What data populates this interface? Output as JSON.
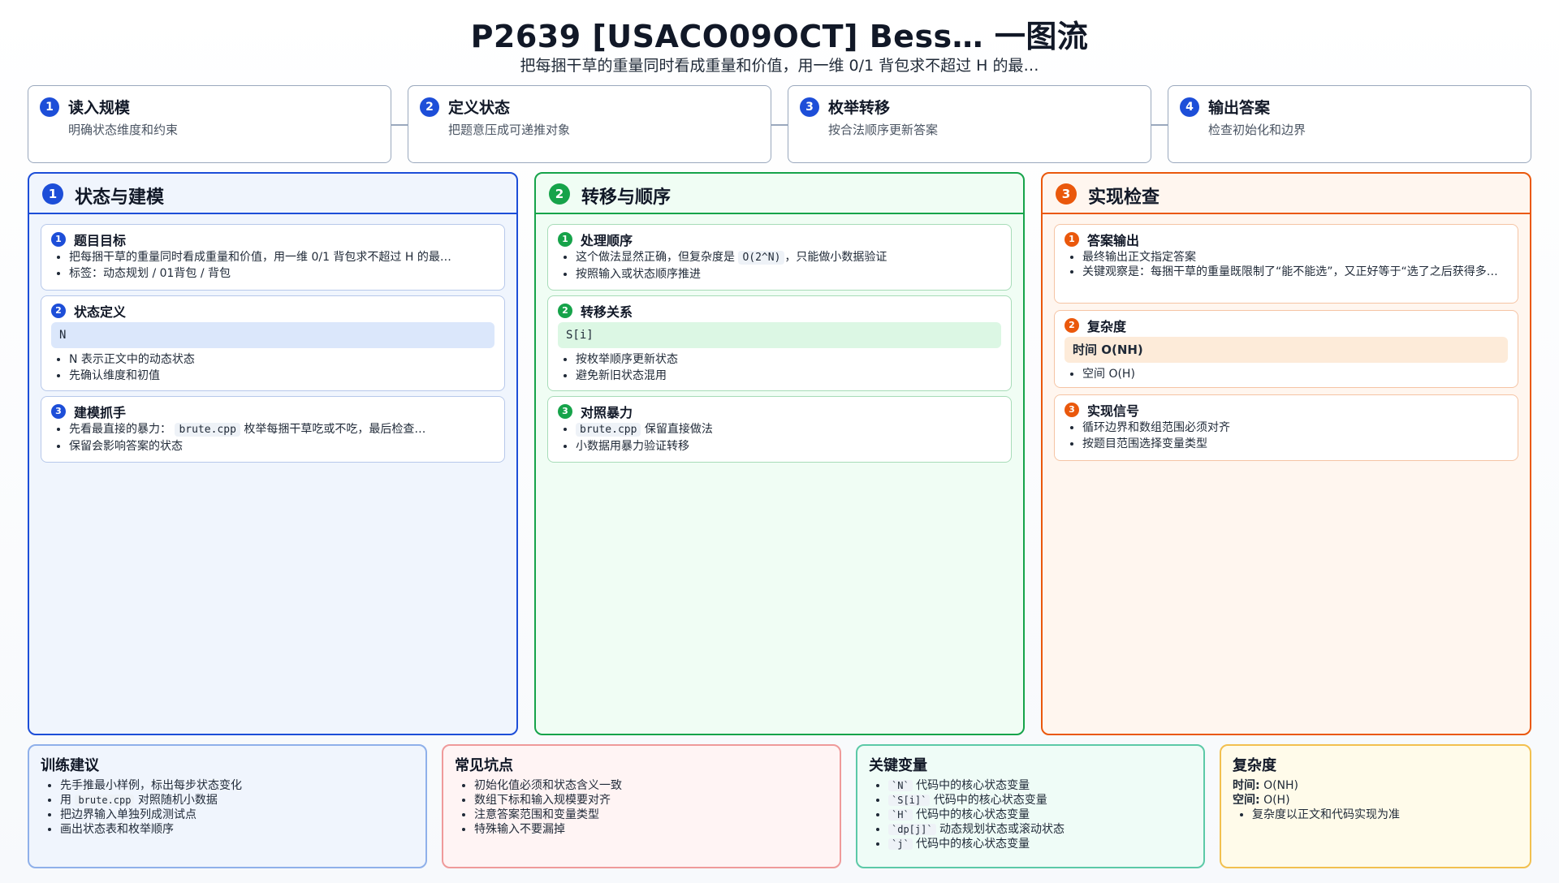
{
  "header": {
    "title": "P2639 [USACO09OCT] Bess… 一图流",
    "subtitle": "把每捆干草的重量同时看成重量和价值，用一维 0/1 背包求不超过 H 的最…"
  },
  "steps": [
    {
      "num": "1",
      "title": "读入规模",
      "desc": "明确状态维度和约束"
    },
    {
      "num": "2",
      "title": "定义状态",
      "desc": "把题意压成可递推对象"
    },
    {
      "num": "3",
      "title": "枚举转移",
      "desc": "按合法顺序更新答案"
    },
    {
      "num": "4",
      "title": "输出答案",
      "desc": "检查初始化和边界"
    }
  ],
  "colors": {
    "blue": "#1d4ed8",
    "green": "#16a34a",
    "orange": "#ea580c",
    "blue_bg": "#f0f5fd",
    "green_bg": "#f0fdf4",
    "orange_bg": "#fff6ef"
  },
  "columns": {
    "c1": {
      "num": "1",
      "title": "状态与建模",
      "cards": {
        "a": {
          "num": "1",
          "title": "题目目标",
          "items": [
            "把每捆干草的重量同时看成重量和价值，用一维 0/1 背包求不超过 H 的最…",
            "标签：动态规划 / 01背包 / 背包"
          ]
        },
        "b": {
          "num": "2",
          "title": "状态定义",
          "code": "N",
          "items": [
            "N 表示正文中的动态状态",
            "先确认维度和初值"
          ]
        },
        "c": {
          "num": "3",
          "title": "建模抓手",
          "item1_pre": "先看最直接的暴力：",
          "item1_code": "brute.cpp",
          "item1_post": "枚举每捆干草吃或不吃，最后检查…",
          "item2": "保留会影响答案的状态"
        }
      }
    },
    "c2": {
      "num": "2",
      "title": "转移与顺序",
      "cards": {
        "a": {
          "num": "1",
          "title": "处理顺序",
          "item1_pre": "这个做法显然正确，但复杂度是",
          "item1_code": "O(2^N)",
          "item1_post": "，只能做小数据验证",
          "item2": "按照输入或状态顺序推进"
        },
        "b": {
          "num": "2",
          "title": "转移关系",
          "code": "S[i]",
          "items": [
            "按枚举顺序更新状态",
            "避免新旧状态混用"
          ]
        },
        "c": {
          "num": "3",
          "title": "对照暴力",
          "item1_code": "brute.cpp",
          "item1_post": "保留直接做法",
          "item2": "小数据用暴力验证转移"
        }
      }
    },
    "c3": {
      "num": "3",
      "title": "实现检查",
      "cards": {
        "a": {
          "num": "1",
          "title": "答案输出",
          "items": [
            "最终输出正文指定答案",
            "关键观察是：每捆干草的重量既限制了“能不能选”，又正好等于“选了之后获得多…"
          ]
        },
        "b": {
          "num": "2",
          "title": "复杂度",
          "highlight": "时间 O(NH)",
          "items": [
            "空间 O(H)"
          ]
        },
        "c": {
          "num": "3",
          "title": "实现信号",
          "items": [
            "循环边界和数组范围必须对齐",
            "按题目范围选择变量类型"
          ]
        }
      }
    }
  },
  "bottom": {
    "training": {
      "title": "训练建议",
      "item1": "先手推最小样例，标出每步状态变化",
      "item2_pre": "用",
      "item2_code": "brute.cpp",
      "item2_post": "对照随机小数据",
      "item3": "把边界输入单独列成测试点",
      "item4": "画出状态表和枚举顺序"
    },
    "pitfalls": {
      "title": "常见坑点",
      "items": [
        "初始化值必须和状态含义一致",
        "数组下标和输入规模要对齐",
        "注意答案范围和变量类型",
        "特殊输入不要漏掉"
      ]
    },
    "vars": {
      "title": "关键变量",
      "items": [
        {
          "code": "`N`",
          "text": "代码中的核心状态变量"
        },
        {
          "code": "`S[i]`",
          "text": "代码中的核心状态变量"
        },
        {
          "code": "`H`",
          "text": "代码中的核心状态变量"
        },
        {
          "code": "`dp[j]`",
          "text": "动态规划状态或滚动状态"
        },
        {
          "code": "`j`",
          "text": "代码中的核心状态变量"
        }
      ]
    },
    "complexity": {
      "title": "复杂度",
      "time_label": "时间:",
      "time_value": "O(NH)",
      "space_label": "空间:",
      "space_value": "O(H)",
      "note": "复杂度以正文和代码实现为准"
    }
  }
}
